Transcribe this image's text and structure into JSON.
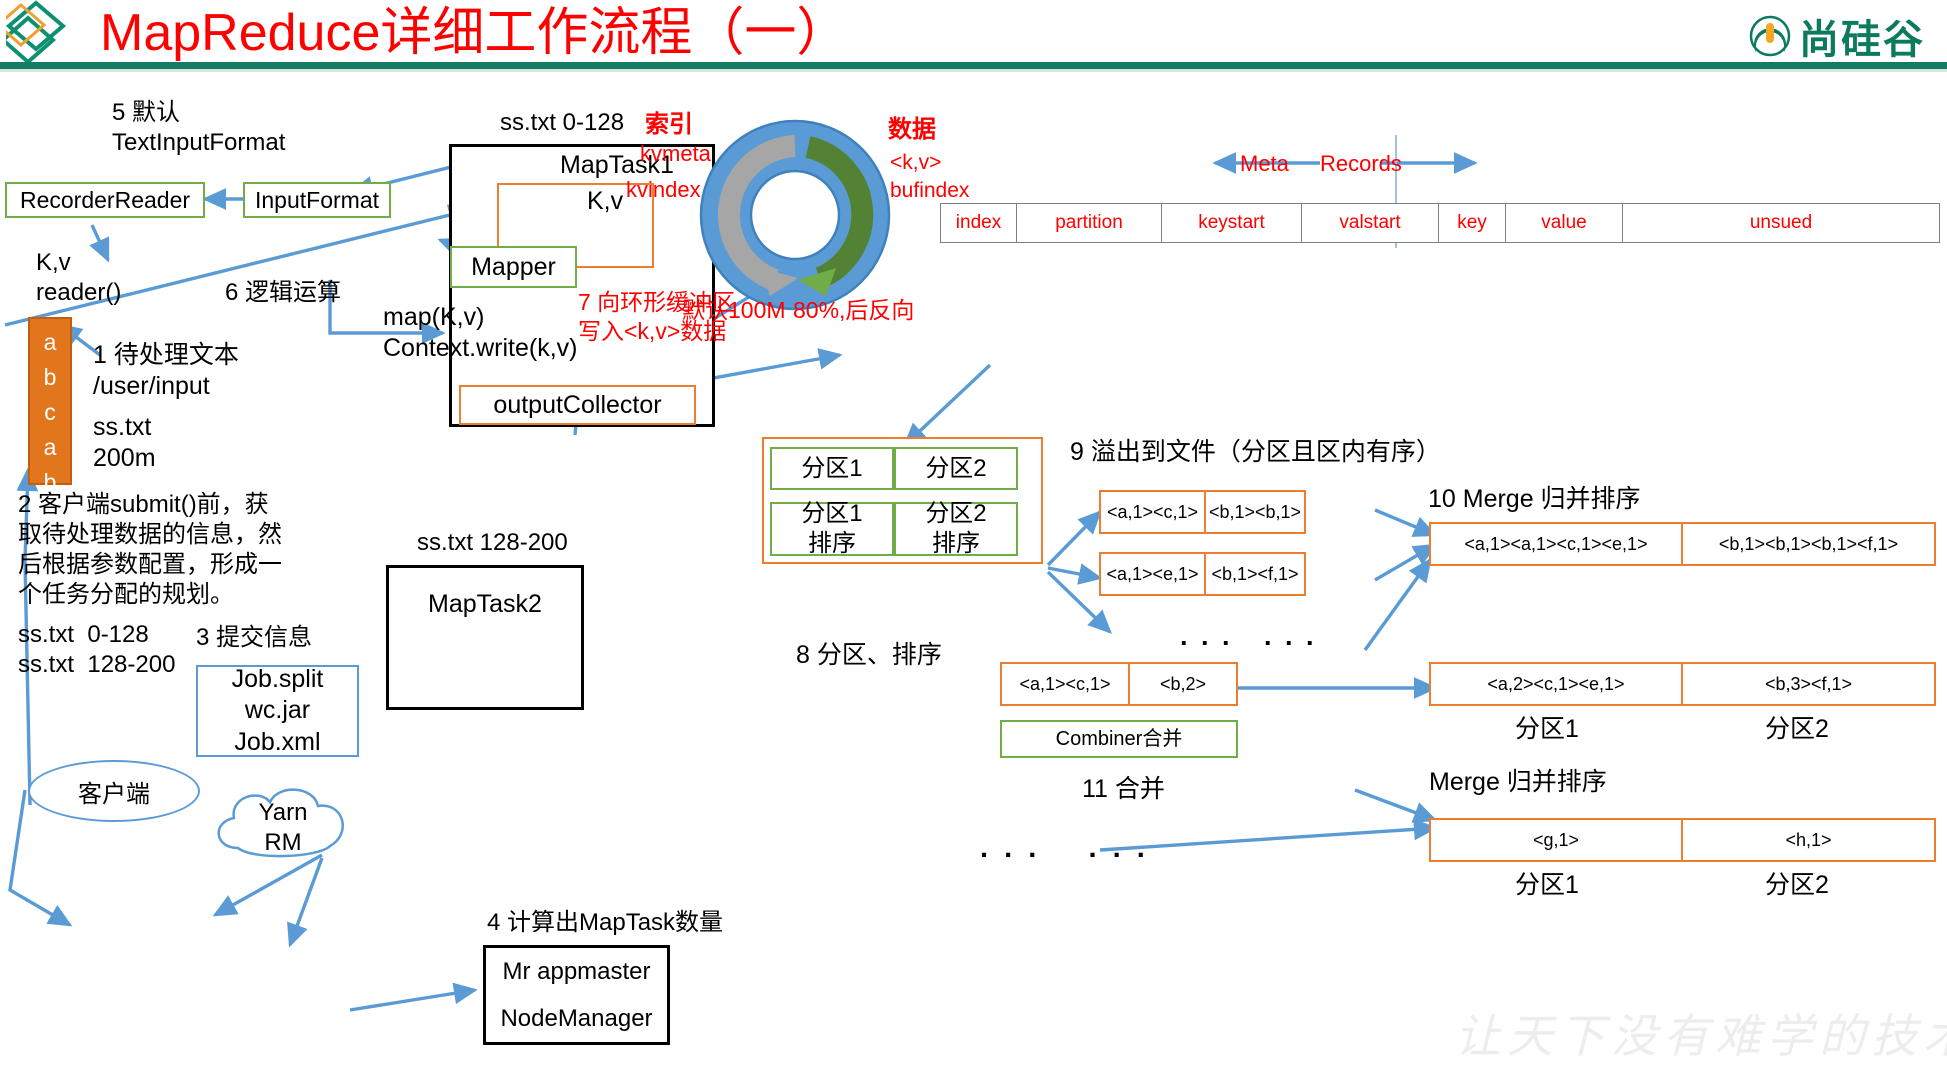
{
  "header": {
    "title": "MapReduce详细工作流程（一）",
    "brand_text": "尚硅谷",
    "title_color": "#ff0000",
    "rule_color": "#127b62"
  },
  "watermark": "让天下没有难学的技术",
  "steps": {
    "s1": "1 待处理文本\n/user/input",
    "s1b": "ss.txt\n200m",
    "s2": "2 客户端submit()前，获\n取待处理数据的信息，然\n后根据参数配置，形成一\n个任务分配的规划。",
    "s2b": "ss.txt  0-128\nss.txt  128-200",
    "s3": "3 提交信息",
    "s4": "4 计算出MapTask数量",
    "s5": "5 默认\nTextInputFormat",
    "s6": "6 逻辑运算",
    "s7": "7 向环形缓冲区\n写入<k,v>数据",
    "s8": "8 分区、排序",
    "s9": "9 溢出到文件（分区且区内有序）",
    "s10": "10 Merge 归并排序",
    "s11": "11 合并",
    "merge_sort": "Merge 归并排序"
  },
  "left": {
    "recorder_reader": "RecorderReader",
    "input_format": "InputFormat",
    "kv_reader": "K,v\nreader()",
    "file_chars": [
      "a",
      "b",
      "c",
      "a",
      "b",
      "…"
    ],
    "job_box": "Job.split\nwc.jar\nJob.xml",
    "client": "客户端",
    "yarn": "Yarn\nRM",
    "appmaster": "Mr appmaster",
    "nodemanager": "NodeManager"
  },
  "maptask1": {
    "caption": "ss.txt 0-128",
    "title": "MapTask1",
    "kv": "K,v",
    "mapper": "Mapper",
    "map_code": "map(K,v)\nContext.write(k,v)",
    "output_collector": "outputCollector"
  },
  "maptask2": {
    "caption": "ss.txt 128-200",
    "title": "MapTask2"
  },
  "buffer": {
    "index_label": "索引",
    "kvmeta": "kvmeta",
    "kvindex": "kvindex",
    "data_label": "数据",
    "kv": "<k,v>",
    "bufindex": "bufindex",
    "size": "默认100M",
    "spill": "80%,后反向"
  },
  "meta_table": {
    "meta_label": "Meta",
    "records_label": "Records",
    "cells": [
      "index",
      "partition",
      "keystart",
      "valstart",
      "key",
      "value",
      "unsued"
    ]
  },
  "partitions": {
    "p1": "分区1",
    "p2": "分区2",
    "p1_sorted": "分区1\n排序",
    "p2_sorted": "分区2\n排序"
  },
  "spill_files": {
    "row1": [
      "<a,1><c,1>",
      "<b,1><b,1>"
    ],
    "row2": [
      "<a,1><e,1>",
      "<b,1><f,1>"
    ],
    "dots": ". . .   . . ."
  },
  "merge": {
    "row": [
      "<a,1><a,1><c,1><e,1>",
      "<b,1><b,1><b,1><f,1>"
    ]
  },
  "combiner": {
    "row": [
      "<a,1><c,1>",
      "<b,2>"
    ],
    "label": "Combiner合并"
  },
  "final": {
    "row1": [
      "<a,2><c,1><e,1>",
      "<b,3><f,1>"
    ],
    "row1_labels": [
      "分区1",
      "分区2"
    ],
    "row2": [
      "<g,1>",
      "<h,1>"
    ],
    "row2_labels": [
      "分区1",
      "分区2"
    ],
    "dots": ". . .    . . ."
  },
  "colors": {
    "green": "#70ad47",
    "orange": "#ed7d31",
    "blue": "#5b9bd5",
    "red": "#ff0000",
    "black": "#000000"
  }
}
